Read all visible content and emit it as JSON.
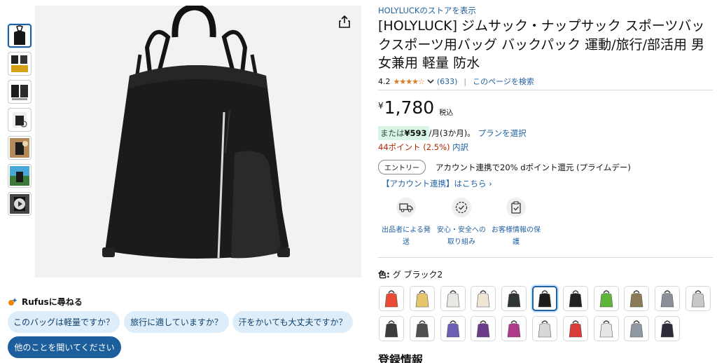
{
  "store_link": "HOLYLUCKのストアを表示",
  "product_title": "[HOLYLUCK] ジムサック・ナップサック スポーツバックスポーツ用バッグ バックパック 運動/旅行/部活用 男女兼用 軽量 防水",
  "rating": {
    "value": "4.2",
    "stars": "★★★★☆",
    "count": "(633)",
    "separator": "|",
    "search_link": "このページを検索"
  },
  "price": {
    "symbol": "¥",
    "amount": "1,780",
    "tax_label": "税込"
  },
  "installment": {
    "prefix": "または",
    "amount": "¥593",
    "suffix": "/月(3か月)。",
    "plan_link": "プランを選択"
  },
  "points": {
    "value": "44ポイント (2.5%)",
    "detail_link": "内訳"
  },
  "entry": {
    "button": "エントリー",
    "text": "アカウント連携で20% dポイント還元 (プライムデー)"
  },
  "account_link": "【アカウント連携】はこちら ›",
  "features": [
    {
      "icon": "truck-icon",
      "label": "出品者による発送"
    },
    {
      "icon": "shield-check-icon",
      "label": "安心・安全への取り組み"
    },
    {
      "icon": "secure-clipboard-icon",
      "label": "お客様情報の保護"
    }
  ],
  "color": {
    "label": "色:",
    "selected": "グ ブラック2"
  },
  "swatch_colors": [
    [
      "#e94b35",
      "#e6c66b",
      "#e8e8e4",
      "#efe6d5",
      "#2f3434",
      "#1b1b1b",
      "#222222",
      "#5db53a",
      "#8a7a55",
      "#8a8f99",
      "#c9c9c9"
    ],
    [
      "#3c3c3c",
      "#505050",
      "#6b5fb5",
      "#6a3c8a",
      "#b03a8a",
      "#d8d8d8",
      "#d93a3a",
      "#e6e6e6",
      "#8f98a3",
      "#2b2b3a"
    ]
  ],
  "rufus": {
    "title": "Rufusに尋ねる",
    "chips": [
      "このバッグは軽量ですか？",
      "旅行に適していますか？",
      "汗をかいても大丈夫ですか？",
      "他のことを聞いてください"
    ]
  },
  "registration_title": "登録情報",
  "colors": {
    "link": "#2162a1",
    "price_points_red": "#b12704",
    "star": "#de7921",
    "selected_border": "#2162a1",
    "chip_bg": "#ddeefa",
    "chip_dark": "#1d5f9c"
  }
}
